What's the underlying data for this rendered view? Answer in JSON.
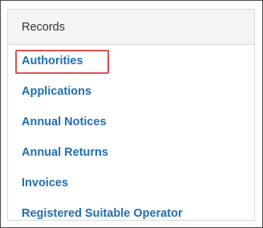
{
  "panel": {
    "header": "Records",
    "links": [
      {
        "label": "Authorities",
        "highlighted": true
      },
      {
        "label": "Applications",
        "highlighted": false
      },
      {
        "label": "Annual Notices",
        "highlighted": false
      },
      {
        "label": "Annual Returns",
        "highlighted": false
      },
      {
        "label": "Invoices",
        "highlighted": false
      },
      {
        "label": "Registered Suitable Operator",
        "highlighted": false
      }
    ]
  },
  "colors": {
    "link": "#1f6fb2",
    "highlight_border": "#e05050",
    "header_bg": "#f4f4f4"
  }
}
